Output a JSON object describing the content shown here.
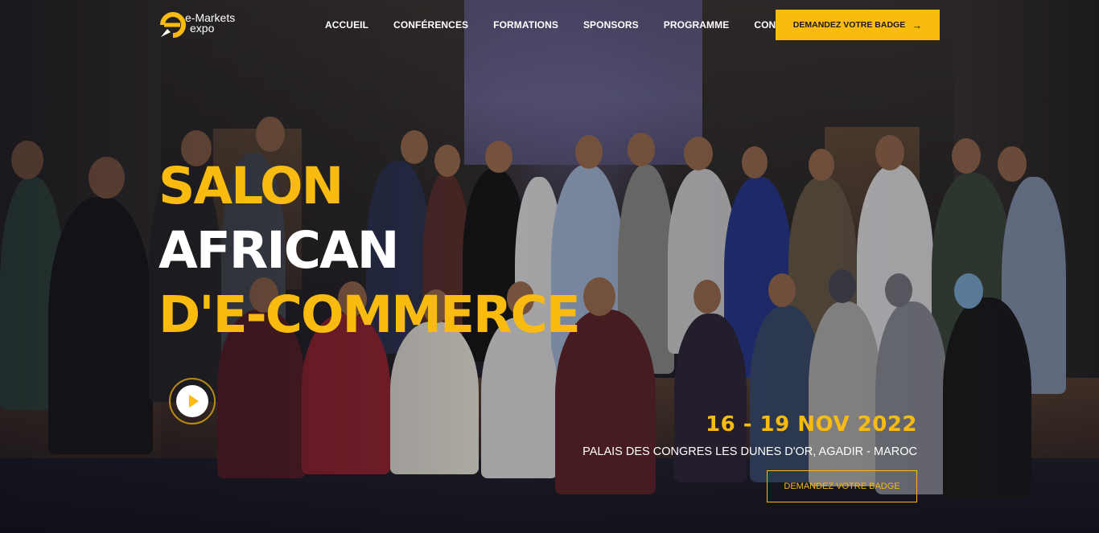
{
  "brand": {
    "logo_line1": "e-Markets",
    "logo_line2": "expo",
    "logo_icon": "e-rocket-logo-icon",
    "accent_color": "#f9bb0f"
  },
  "nav": {
    "items": [
      {
        "label": "ACCUEIL"
      },
      {
        "label": "CONFÉRENCES"
      },
      {
        "label": "FORMATIONS"
      },
      {
        "label": "SPONSORS"
      },
      {
        "label": "PROGRAMME"
      },
      {
        "label": "CONTACT"
      }
    ],
    "cta_label": "DEMANDEZ VOTRE BADGE",
    "cta_icon": "arrow-right-icon"
  },
  "hero": {
    "title_line1": "SALON",
    "title_line2": "AFRICAN",
    "title_line3": "D'E-COMMERCE",
    "play_icon": "play-icon",
    "date": "16 - 19 NOV 2022",
    "venue": "PALAIS DES CONGRES LES DUNES D'OR, AGADIR - MAROC",
    "cta_label": "DEMANDEZ VOTRE BADGE"
  }
}
